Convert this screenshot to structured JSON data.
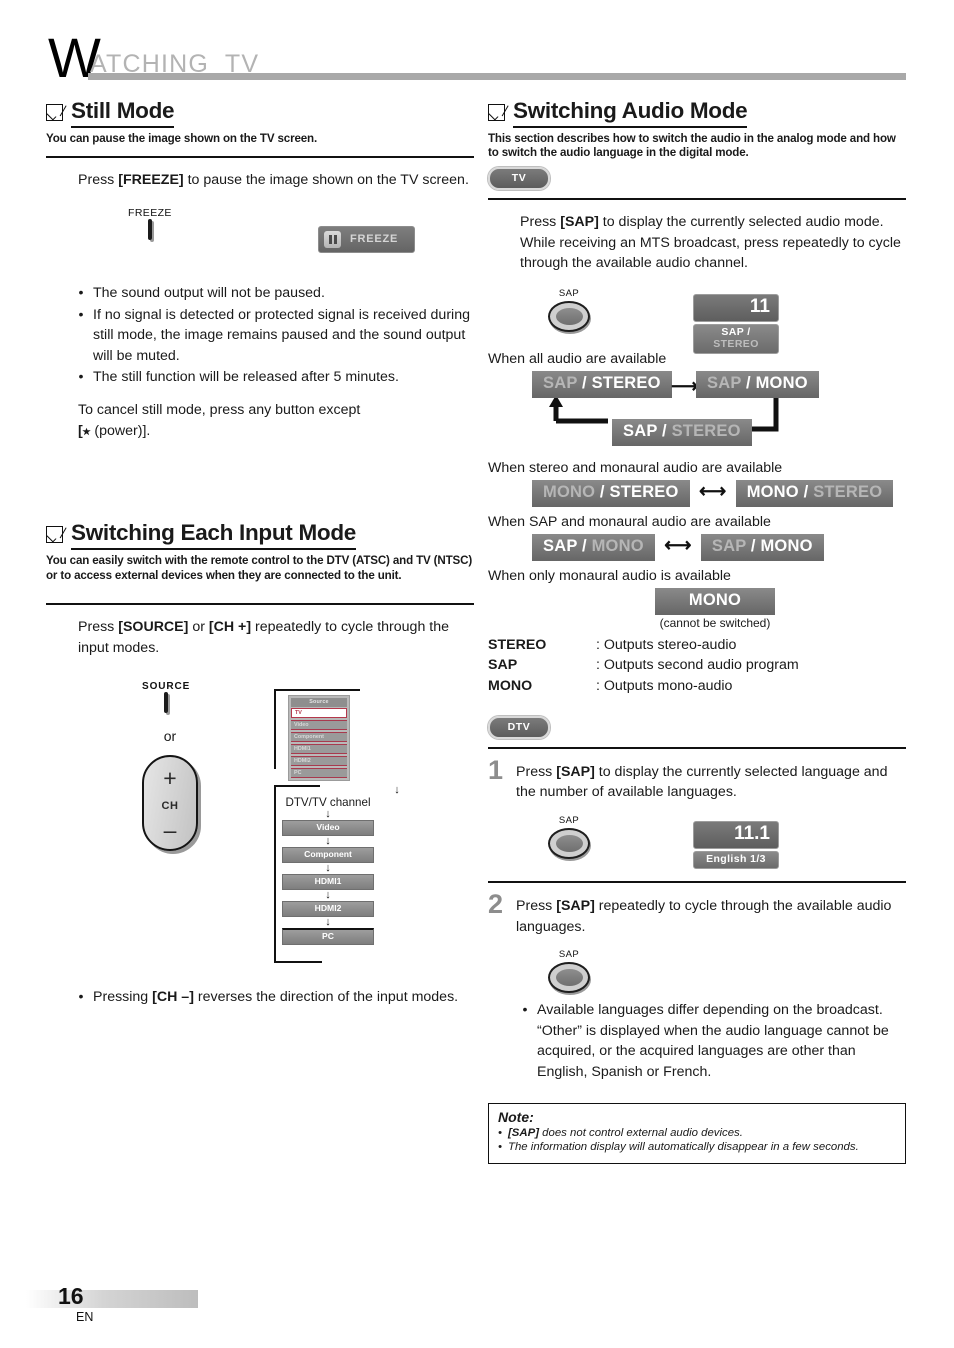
{
  "header": {
    "first_letter": "W",
    "rest": "ATCHING  TV"
  },
  "footer": {
    "page": "16",
    "lang": "EN"
  },
  "left": {
    "still": {
      "title": "Still Mode",
      "subtitle": "You can pause the image shown on the TV screen.",
      "instruction_prefix": "Press ",
      "instruction_key": "[FREEZE]",
      "instruction_suffix": " to pause the image shown on the TV screen.",
      "remote_label": "FREEZE",
      "osd_label": "FREEZE",
      "bullets": [
        "The sound output will not be paused.",
        "If no signal is detected or protected signal is received during still mode, the image remains paused and the sound output will be muted.",
        "The still function will be released after 5 minutes."
      ],
      "cancel_line1": "To cancel still mode, press any button except",
      "cancel_line2_pre": "[",
      "cancel_line2_post": " (power)].",
      "power_icon": "power-icon"
    },
    "input": {
      "title": "Switching Each Input Mode",
      "subtitle": "You can easily switch with the remote control to the DTV (ATSC) and TV (NTSC) or to access external devices when they are connected to the unit.",
      "instruction": "Press [SOURCE] or [CH +] repeatedly to cycle through the input modes.",
      "instr_p1": "Press ",
      "instr_k1": "[SOURCE]",
      "instr_p2": " or ",
      "instr_k2": "[CH +]",
      "instr_p3": " repeatedly to cycle through the input modes.",
      "source_button_label": "SOURCE",
      "or_label": "or",
      "ch_plus": "+",
      "ch_label": "CH",
      "ch_minus": "–",
      "menu": {
        "header": "Source",
        "items": [
          "TV",
          "Video",
          "Component",
          "HDMI1",
          "HDMI2",
          "PC"
        ],
        "selected": "TV"
      },
      "flow": {
        "channel_label": "DTV/TV channel",
        "items": [
          "Video",
          "Component",
          "HDMI1",
          "HDMI2",
          "PC"
        ]
      },
      "footnote_pre": "Pressing ",
      "footnote_key": "[CH –]",
      "footnote_post": " reverses the direction of the input modes."
    }
  },
  "right": {
    "audio": {
      "title": "Switching Audio Mode",
      "subtitle": "This section describes how to switch the audio in the analog mode and how to switch the audio language in the digital mode.",
      "tv_badge": "TV",
      "dtv_badge": "DTV",
      "tv_instruction_p1": "Press ",
      "tv_instruction_k1": "[SAP]",
      "tv_instruction_p2": " to display the currently selected audio mode. While receiving an MTS broadcast, press repeatedly to cycle through the available audio channel.",
      "sap_button_label": "SAP",
      "osd_channel": "11",
      "osd_mode_active": "SAP",
      "osd_mode_sep": " / ",
      "osd_mode_dim": "STEREO",
      "case1_caption": "When all audio are available",
      "case1_boxes": [
        {
          "left": "SAP",
          "left_active": false,
          "right": "STEREO",
          "right_active": true
        },
        {
          "left": "SAP",
          "left_active": false,
          "right": "MONO",
          "right_active": true
        },
        {
          "left": "SAP",
          "left_active": true,
          "right": "STEREO",
          "right_active": false
        }
      ],
      "case2_caption": "When stereo and monaural audio are available",
      "case2_boxes": [
        {
          "left": "MONO",
          "left_active": false,
          "right": "STEREO",
          "right_active": true
        },
        {
          "left": "MONO",
          "left_active": true,
          "right": "STEREO",
          "right_active": false
        }
      ],
      "case3_caption": "When SAP and monaural audio are available",
      "case3_boxes": [
        {
          "left": "SAP",
          "left_active": true,
          "right": "MONO",
          "right_active": false
        },
        {
          "left": "SAP",
          "left_active": false,
          "right": "MONO",
          "right_active": true
        }
      ],
      "case4_caption": "When only monaural audio is available",
      "case4_box": "MONO",
      "case4_note": "(cannot be switched)",
      "legend": [
        {
          "key": "STEREO",
          "val": ": Outputs stereo-audio"
        },
        {
          "key": "SAP",
          "val": ": Outputs second audio program"
        },
        {
          "key": "MONO",
          "val": ": Outputs mono-audio"
        }
      ],
      "step1_num": "1",
      "step1_p1": "Press ",
      "step1_k1": "[SAP]",
      "step1_p2": " to display the currently selected language and the number of available languages.",
      "step1_osd_channel": "11.1",
      "step1_osd_sub": "English 1/3",
      "step2_num": "2",
      "step2_p1": "Press ",
      "step2_k1": "[SAP]",
      "step2_p2": " repeatedly to cycle through the available audio languages.",
      "step2_bullet": "Available languages differ depending on the broadcast. “Other” is displayed when the audio language cannot be acquired, or the acquired languages are other than English, Spanish or French.",
      "note_title": "Note:",
      "note_items_html": [
        "<b>[SAP]</b> does not control external audio devices.",
        "The information display will automatically disappear in a few seconds."
      ]
    }
  },
  "colors": {
    "header_rule": "#a9a9a9",
    "header_text": "#b3b3b3",
    "osd_gray": "#6f6f6f",
    "badge_gray": "#5c5c5c",
    "menu_accent": "#b4384c",
    "step_num": "#8d8d8d"
  }
}
